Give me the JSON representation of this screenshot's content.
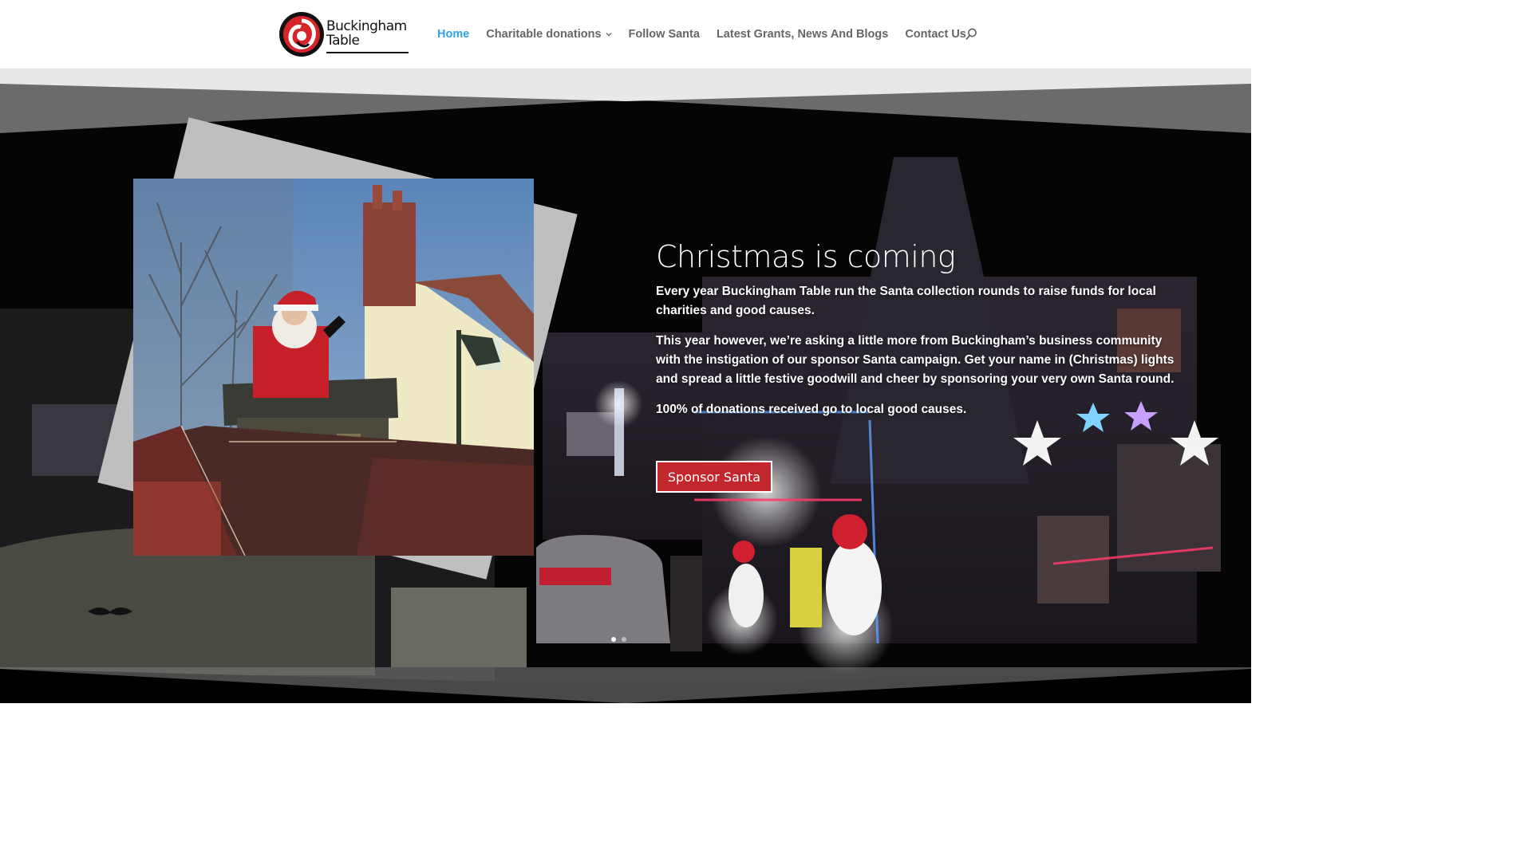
{
  "logo": {
    "line1": "Buckingham",
    "line2": "Table"
  },
  "nav": {
    "items": [
      {
        "label": "Home",
        "active": true,
        "dropdown": false
      },
      {
        "label": "Charitable donations",
        "active": false,
        "dropdown": true
      },
      {
        "label": "Follow Santa",
        "active": false,
        "dropdown": false
      },
      {
        "label": "Latest Grants, News And Blogs",
        "active": false,
        "dropdown": false
      },
      {
        "label": "Contact Us",
        "active": false,
        "dropdown": false
      }
    ],
    "search_icon": "search-icon"
  },
  "hero": {
    "title": "Christmas is coming",
    "paragraphs": [
      "Every year Buckingham Table run the Santa collection rounds to raise funds for local charities and good causes.",
      "This year however, we’re asking a little more from Buckingham’s business community with the instigation of our sponsor Santa campaign. Get your name in (Christmas) lights and spread a little festive goodwill and cheer by sponsoring your very own Santa round.",
      "100% of donations received go to local good causes."
    ],
    "button_label": "Sponsor Santa",
    "slides": {
      "count": 2,
      "active": 1
    }
  },
  "colors": {
    "accent": "#2ea3f2",
    "nav_text": "#666666",
    "button": "#c1272d",
    "logo_red": "#d9232a"
  }
}
